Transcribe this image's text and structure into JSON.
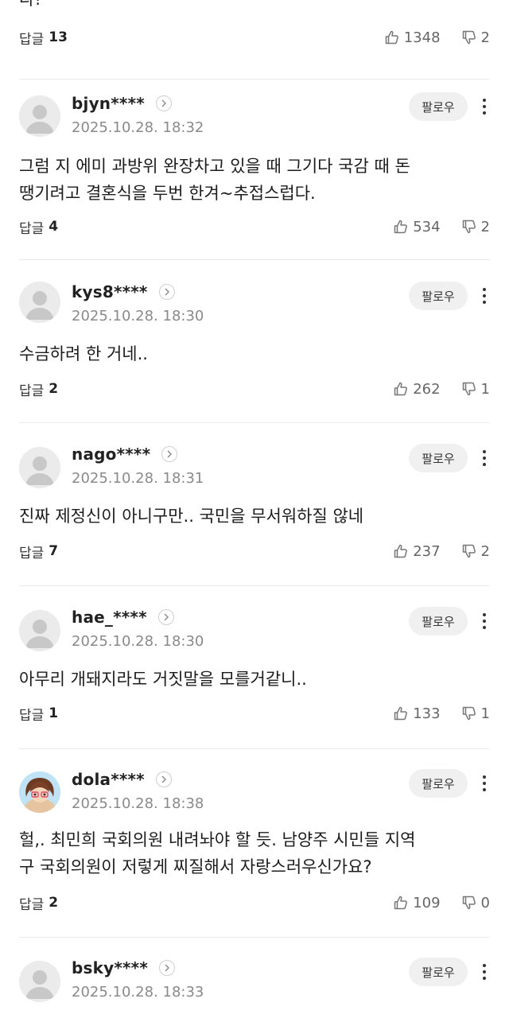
{
  "top_partial": {
    "text_tail": "다!",
    "reply_label": "답글",
    "reply_count": "13",
    "likes": "1348",
    "dislikes": "2"
  },
  "follow_label": "팔로우",
  "reply_label": "답글",
  "comments": [
    {
      "username": "bjyn****",
      "timestamp": "2025.10.28. 18:32",
      "text_lines": [
        "그럼 지 에미 과방위 완장차고 있을 때 그기다 국감 때 돈",
        "땡기려고 결혼식을 두번 한겨~추접스럽다."
      ],
      "reply_count": "4",
      "likes": "534",
      "dislikes": "2",
      "avatar": "default-avatar"
    },
    {
      "username": "kys8****",
      "timestamp": "2025.10.28. 18:30",
      "text_lines": [
        "수금하려 한 거네.."
      ],
      "reply_count": "2",
      "likes": "262",
      "dislikes": "1",
      "avatar": "default-avatar"
    },
    {
      "username": "nago****",
      "timestamp": "2025.10.28. 18:31",
      "text_lines": [
        "진짜 제정신이 아니구만.. 국민을 무서워하질 않네"
      ],
      "reply_count": "7",
      "likes": "237",
      "dislikes": "2",
      "avatar": "default-avatar"
    },
    {
      "username": "hae_****",
      "timestamp": "2025.10.28. 18:30",
      "text_lines": [
        "아무리 개돼지라도 거짓말을 모를거같니.."
      ],
      "reply_count": "1",
      "likes": "133",
      "dislikes": "1",
      "avatar": "default-avatar"
    },
    {
      "username": "dola****",
      "timestamp": "2025.10.28. 18:38",
      "text_lines": [
        "헐,. 최민희 국회의원 내려놔야 할 듯. 남양주 시민들 지역",
        "구 국회의원이 저렇게 찌질해서 자랑스러우신가요?"
      ],
      "reply_count": "2",
      "likes": "109",
      "dislikes": "0",
      "avatar": "character-avatar"
    },
    {
      "username": "bsky****",
      "timestamp": "2025.10.28. 18:33",
      "text_lines": [],
      "reply_count": "",
      "likes": "",
      "dislikes": "",
      "avatar": "default-avatar"
    }
  ],
  "icons": {
    "like": "thumbs-up-icon",
    "dislike": "thumbs-down-icon",
    "profile_link": "chevron-right-icon",
    "more": "more-vertical-icon"
  },
  "colors": {
    "text": "#1c1c1c",
    "muted": "#8a8a8a",
    "button_bg": "#f0f0f0",
    "divider": "#ececec"
  }
}
